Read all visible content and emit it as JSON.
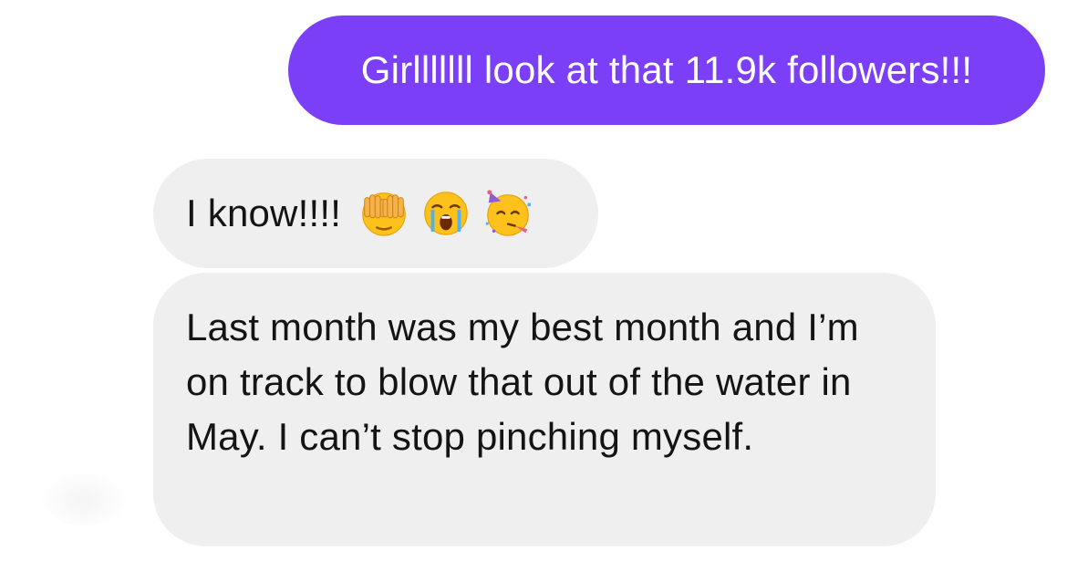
{
  "conversation": {
    "messages": [
      {
        "direction": "sent",
        "text": "Girlllllll look at that 11.9k followers!!!",
        "color": "#7a3ff6"
      },
      {
        "direction": "received",
        "text": "I know!!!!",
        "emojis": [
          "hands-over-face-emoji",
          "crying-face-emoji",
          "partying-face-emoji"
        ],
        "color": "#efefef"
      },
      {
        "direction": "received",
        "text": "Last month was my best month and I’m on track to blow that out of the water in May. I can’t stop pinching myself.",
        "color": "#efefef"
      }
    ]
  }
}
